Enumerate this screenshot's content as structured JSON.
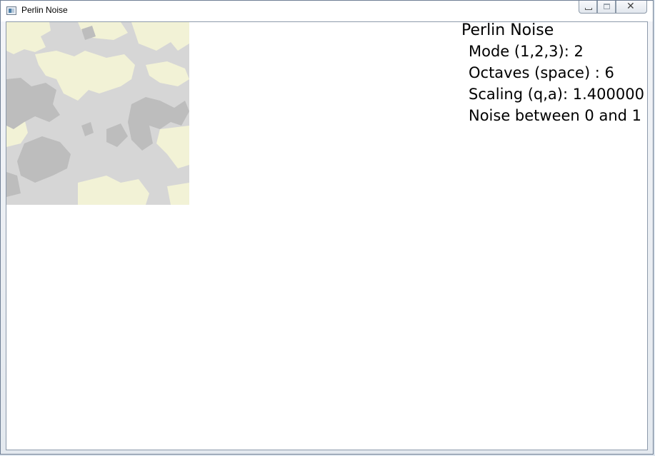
{
  "window": {
    "title": "Perlin Noise",
    "icon": "app-window-icon",
    "caption_buttons": [
      {
        "name": "minimize-button",
        "icon": "minimize-icon"
      },
      {
        "name": "maximize-button",
        "icon": "maximize-icon"
      },
      {
        "name": "close-button",
        "icon": "close-icon",
        "glyph": "✕"
      }
    ]
  },
  "overlay": {
    "title": "Perlin Noise",
    "mode": "Mode (1,2,3): 2",
    "octaves": "Octaves (space) : 6",
    "scaling": "Scaling (q,a): 1.400000",
    "range": "Noise between 0 and 1"
  },
  "colors": {
    "noise_dark": "#bdbdbd",
    "noise_mid": "#d6d6d6",
    "noise_light": "#f2f2d6",
    "client_bg": "#ffffff"
  }
}
